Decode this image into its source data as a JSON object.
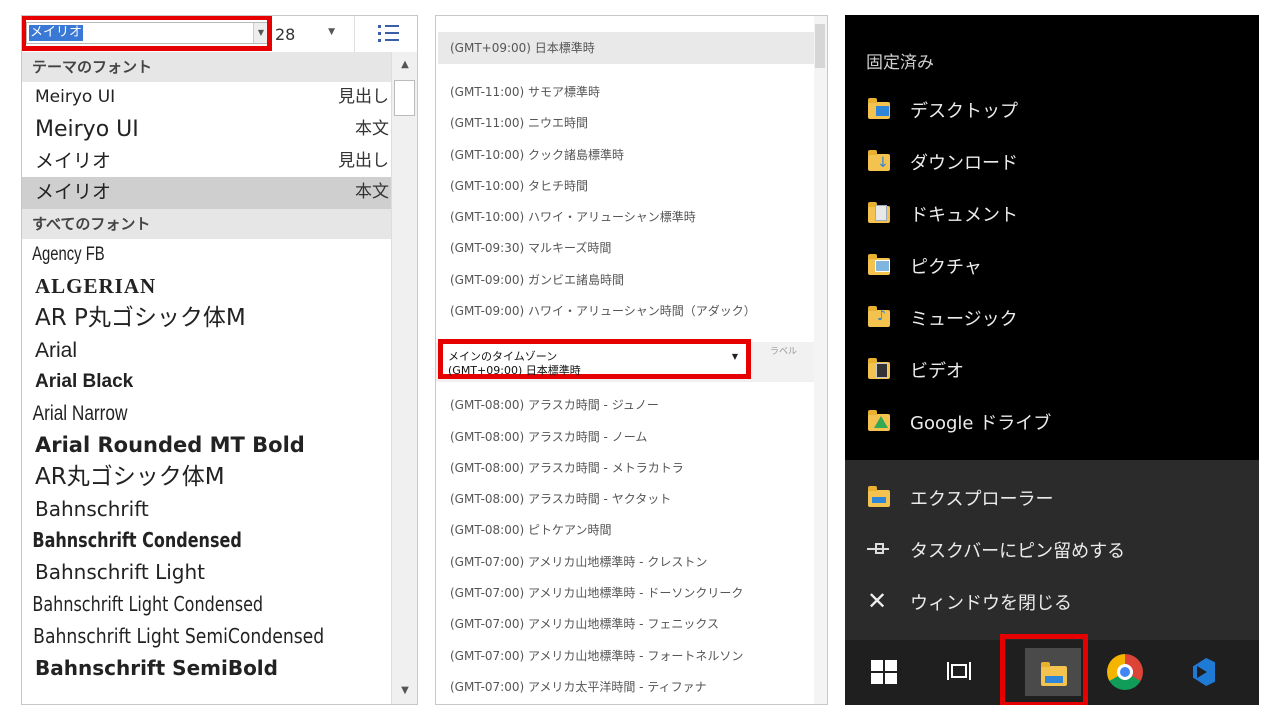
{
  "font_panel": {
    "font_name": "メイリオ",
    "font_size": "28",
    "theme_section": "テーマのフォント",
    "theme_fonts": [
      {
        "name": "Meiryo  UI",
        "tag": "見出し"
      },
      {
        "name": "Meiryo UI",
        "tag": "本文"
      },
      {
        "name": "メイリオ",
        "tag": "見出し"
      },
      {
        "name": "メイリオ",
        "tag": "本文"
      }
    ],
    "all_section": "すべてのフォント",
    "all_fonts": [
      "Agency FB",
      "ALGERIAN",
      "AR  P丸ゴシック体M",
      "Arial",
      "Arial Black",
      "Arial Narrow",
      "Arial Rounded MT Bold",
      "AR丸ゴシック体M",
      "Bahnschrift",
      "Bahnschrift Condensed",
      "Bahnschrift Light",
      "Bahnschrift Light Condensed",
      "Bahnschrift Light SemiCondensed",
      "Bahnschrift SemiBold"
    ]
  },
  "tz_panel": {
    "selected": "(GMT+09:00) 日本標準時",
    "items_top": [
      "(GMT-11:00) サモア標準時",
      "(GMT-11:00) ニウエ時間",
      "(GMT-10:00) クック諸島標準時",
      "(GMT-10:00) タヒチ時間",
      "(GMT-10:00) ハワイ・アリューシャン標準時",
      "(GMT-09:30) マルキーズ時間",
      "(GMT-09:00) ガンビエ諸島時間",
      "(GMT-09:00) ハワイ・アリューシャン時間（アダック）"
    ],
    "dropdown_label": "メインのタイムゾーン",
    "dropdown_value": "(GMT+09:00) 日本標準時",
    "side_label": "ラベル",
    "items_bottom": [
      "(GMT-08:00) アラスカ時間 - ジュノー",
      "(GMT-08:00) アラスカ時間 - ノーム",
      "(GMT-08:00) アラスカ時間 - メトラカトラ",
      "(GMT-08:00) アラスカ時間 - ヤクタット",
      "(GMT-08:00) ピトケアン時間",
      "(GMT-07:00) アメリカ山地標準時 - クレストン",
      "(GMT-07:00) アメリカ山地標準時 - ドーソンクリーク",
      "(GMT-07:00) アメリカ山地標準時 - フェニックス",
      "(GMT-07:00) アメリカ山地標準時 - フォートネルソン",
      "(GMT-07:00) アメリカ太平洋時間 - ティファナ"
    ]
  },
  "jump_list": {
    "header": "固定済み",
    "pinned": [
      {
        "label": "デスクトップ",
        "icon": "desktop-folder-icon"
      },
      {
        "label": "ダウンロード",
        "icon": "downloads-folder-icon"
      },
      {
        "label": "ドキュメント",
        "icon": "documents-folder-icon"
      },
      {
        "label": "ピクチャ",
        "icon": "pictures-folder-icon"
      },
      {
        "label": "ミュージック",
        "icon": "music-folder-icon"
      },
      {
        "label": "ビデオ",
        "icon": "videos-folder-icon"
      },
      {
        "label": "Google ドライブ",
        "icon": "google-drive-folder-icon"
      }
    ],
    "actions": [
      {
        "label": "エクスプローラー",
        "icon": "explorer-icon"
      },
      {
        "label": "タスクバーにピン留めする",
        "icon": "pin-icon"
      },
      {
        "label": "ウィンドウを閉じる",
        "icon": "close-icon"
      }
    ],
    "taskbar": [
      "windows-start-icon",
      "task-view-icon",
      "file-explorer-icon",
      "chrome-icon",
      "vscode-icon"
    ]
  },
  "colors": {
    "highlight_red": "#e60000",
    "selection_blue": "#3a78d6",
    "jump_bg": "#000000",
    "taskbar_bg": "#1f1f1f"
  }
}
